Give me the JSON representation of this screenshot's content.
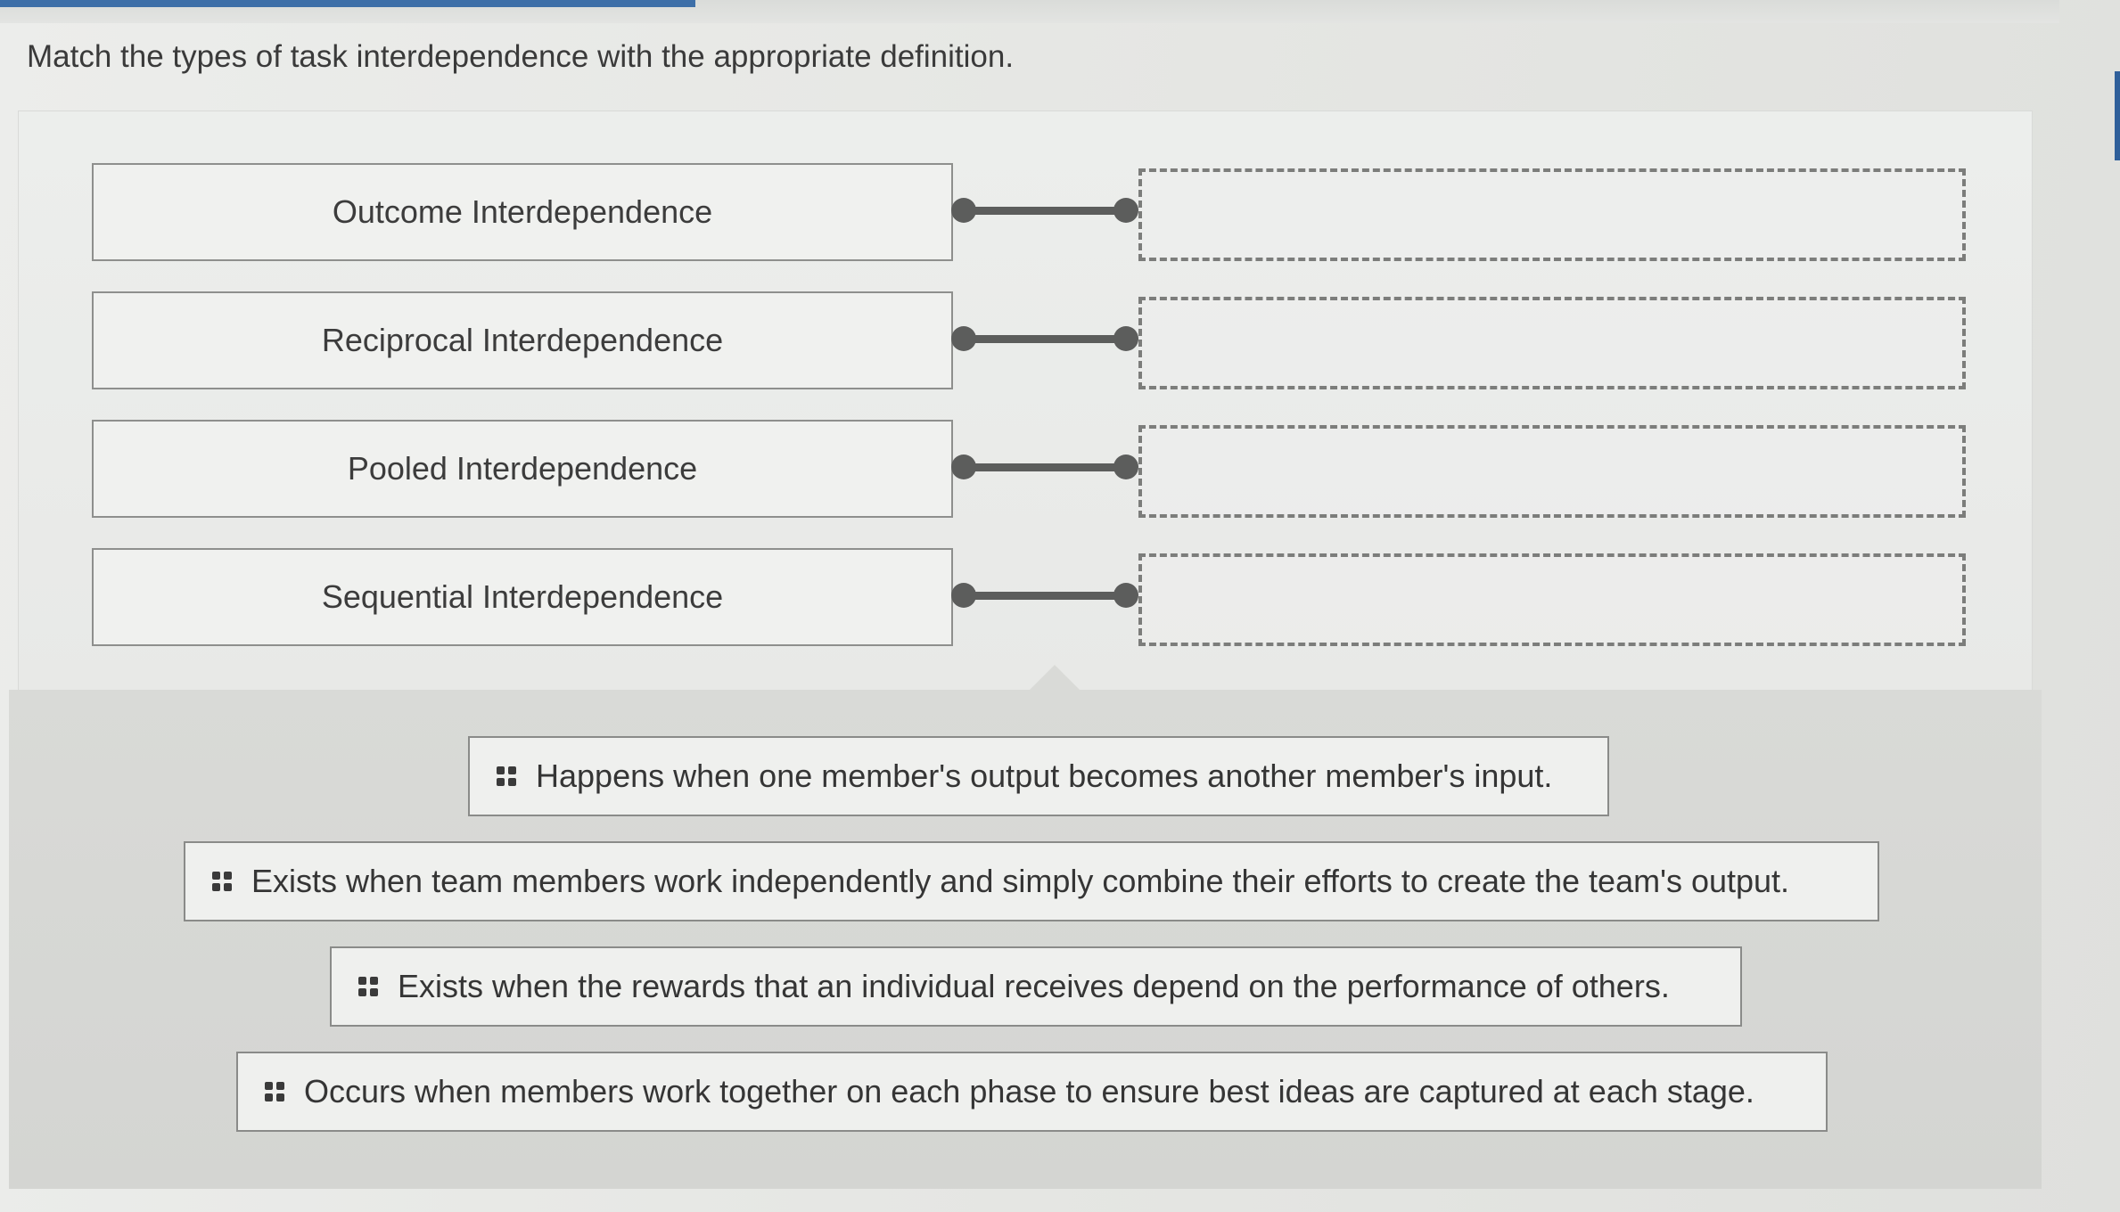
{
  "question": "Match the types of task interdependence with the appropriate definition.",
  "terms": [
    {
      "label": "Outcome Interdependence"
    },
    {
      "label": "Reciprocal Interdependence"
    },
    {
      "label": "Pooled Interdependence"
    },
    {
      "label": "Sequential Interdependence"
    }
  ],
  "definitions": [
    {
      "label": "Happens when one member's output becomes another member's input."
    },
    {
      "label": "Exists when team members work independently and simply combine their efforts to create the team's output."
    },
    {
      "label": "Exists when the rewards that an individual receives depend on the performance of others."
    },
    {
      "label": "Occurs when members work together on each phase to ensure best ideas are captured at each stage."
    }
  ],
  "icons": {
    "drag_handle": "drag-handle-icon"
  },
  "colors": {
    "progress": "#3e6fa8",
    "connector": "#5c5d5c",
    "dropzone_border": "#7c7d7b"
  }
}
